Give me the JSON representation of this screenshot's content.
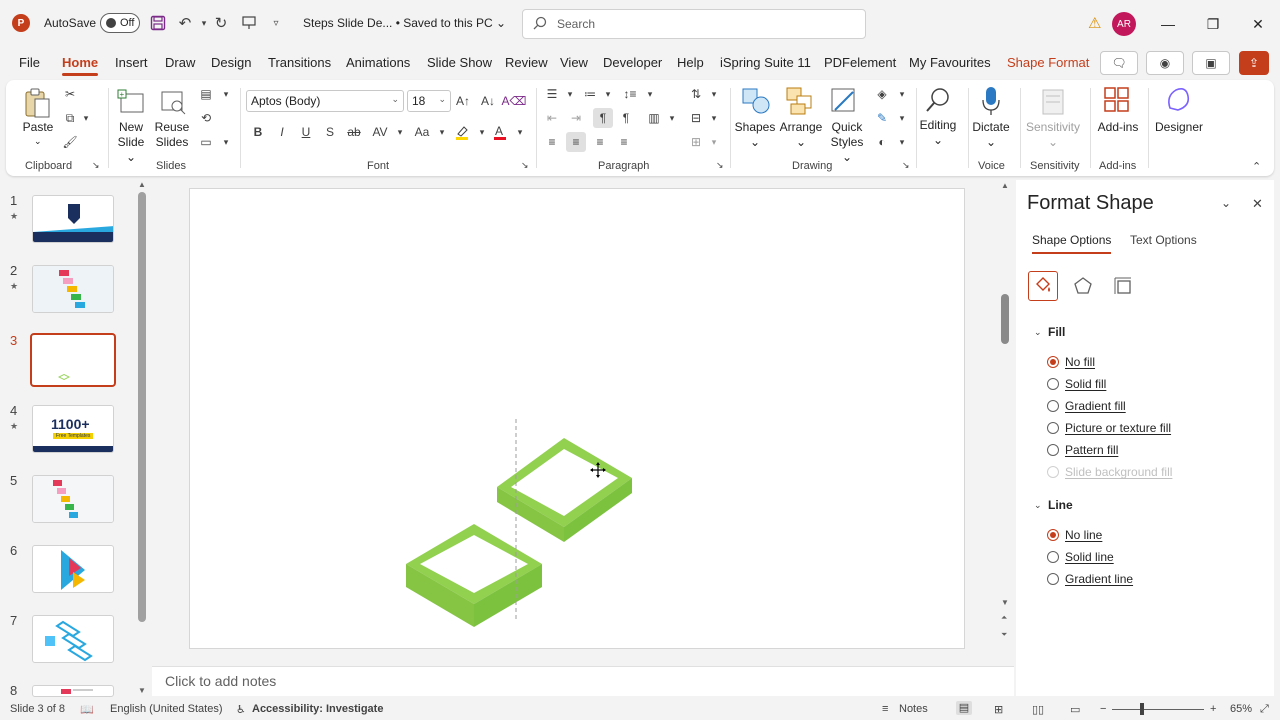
{
  "titlebar": {
    "app_initial": "P",
    "autosave_label": "AutoSave",
    "autosave_state": "Off",
    "doc_title": "Steps Slide De... • Saved to this PC",
    "search_placeholder": "Search",
    "user_initials": "AR"
  },
  "menu": {
    "tabs": [
      "File",
      "Home",
      "Insert",
      "Draw",
      "Design",
      "Transitions",
      "Animations",
      "Slide Show",
      "Review",
      "View",
      "Developer",
      "Help",
      "iSpring Suite 11",
      "PDFelement",
      "My Favourites",
      "Shape Format"
    ],
    "active_tab": "Home"
  },
  "ribbon": {
    "clipboard": {
      "paste": "Paste",
      "label": "Clipboard"
    },
    "slides": {
      "new_slide": "New\nSlide",
      "new_slide_l1": "New",
      "new_slide_l2": "Slide",
      "reuse_l1": "Reuse",
      "reuse_l2": "Slides",
      "label": "Slides"
    },
    "font": {
      "family": "Aptos (Body)",
      "size": "18",
      "label": "Font"
    },
    "paragraph": {
      "label": "Paragraph"
    },
    "drawing": {
      "shapes": "Shapes",
      "arrange": "Arrange",
      "quick_l1": "Quick",
      "quick_l2": "Styles",
      "label": "Drawing"
    },
    "editing": {
      "label_btn": "Editing"
    },
    "voice": {
      "dictate": "Dictate",
      "label": "Voice"
    },
    "sensitivity": {
      "btn": "Sensitivity",
      "label": "Sensitivity"
    },
    "addins": {
      "btn": "Add-ins",
      "label": "Add-ins"
    },
    "designer": {
      "btn": "Designer"
    }
  },
  "thumbnails": {
    "numbers": [
      "1",
      "2",
      "3",
      "4",
      "5",
      "6",
      "7",
      "8"
    ],
    "active": "3",
    "star": "★",
    "slide4_text": "1100+",
    "slide4_sub": "Free Templates"
  },
  "notes": {
    "placeholder": "Click to add notes"
  },
  "format_pane": {
    "title": "Format Shape",
    "tabs": [
      "Shape Options",
      "Text Options"
    ],
    "fill_head": "Fill",
    "fill_options": [
      "No fill",
      "Solid fill",
      "Gradient fill",
      "Picture or texture fill",
      "Pattern fill",
      "Slide background fill"
    ],
    "line_head": "Line",
    "line_options": [
      "No line",
      "Solid line",
      "Gradient line"
    ]
  },
  "statusbar": {
    "slide_info": "Slide 3 of 8",
    "language": "English (United States)",
    "accessibility": "Accessibility: Investigate",
    "notes": "Notes",
    "zoom": "65%"
  },
  "colors": {
    "accent": "#c43e1c",
    "shape_top": "#92d050",
    "shape_side": "#7cc23f"
  }
}
